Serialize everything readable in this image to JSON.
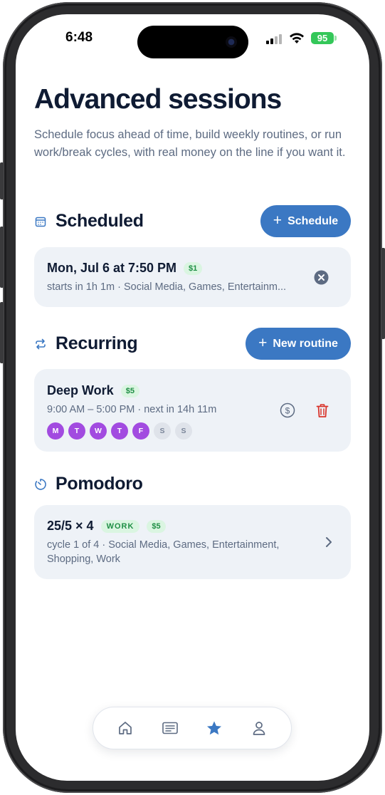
{
  "status_bar": {
    "time": "6:48",
    "battery": "95"
  },
  "page": {
    "title": "Advanced sessions",
    "subtitle": "Schedule focus ahead of time, build weekly routines, or run work/break cycles, with real money on the line if you want it."
  },
  "scheduled": {
    "title": "Scheduled",
    "icon": "calendar-icon",
    "button_label": "Schedule",
    "items": [
      {
        "title": "Mon, Jul 6 at 7:50 PM",
        "stake": "$1",
        "subtitle": "starts in 1h 1m · Social Media, Games, Entertainm..."
      }
    ]
  },
  "recurring": {
    "title": "Recurring",
    "icon": "repeat-icon",
    "button_label": "New routine",
    "items": [
      {
        "title": "Deep Work",
        "stake": "$5",
        "subtitle": "9:00 AM – 5:00 PM · next in 14h 11m",
        "days": [
          {
            "label": "M",
            "active": true
          },
          {
            "label": "T",
            "active": true
          },
          {
            "label": "W",
            "active": true
          },
          {
            "label": "T",
            "active": true
          },
          {
            "label": "F",
            "active": true
          },
          {
            "label": "S",
            "active": false
          },
          {
            "label": "S",
            "active": false
          }
        ]
      }
    ]
  },
  "pomodoro": {
    "title": "Pomodoro",
    "icon": "timer-icon",
    "items": [
      {
        "title": "25/5 × 4",
        "phase": "WORK",
        "stake": "$5",
        "subtitle_line1": "cycle 1 of 4 · Social Media, Games, Entertainment,",
        "subtitle_line2": "Shopping, Work"
      }
    ]
  },
  "tabbar": {
    "tabs": [
      {
        "icon": "home-icon",
        "active": false
      },
      {
        "icon": "list-icon",
        "active": false
      },
      {
        "icon": "star-icon",
        "active": true
      },
      {
        "icon": "profile-icon",
        "active": false
      }
    ]
  },
  "colors": {
    "accent": "#3b78c3",
    "title": "#0f1b33",
    "muted": "#5d6b82",
    "card": "#eef2f7",
    "money": "#1f8f45",
    "money_bg": "#daf5e1",
    "day_active": "#a24be0",
    "delete": "#d9342b"
  }
}
